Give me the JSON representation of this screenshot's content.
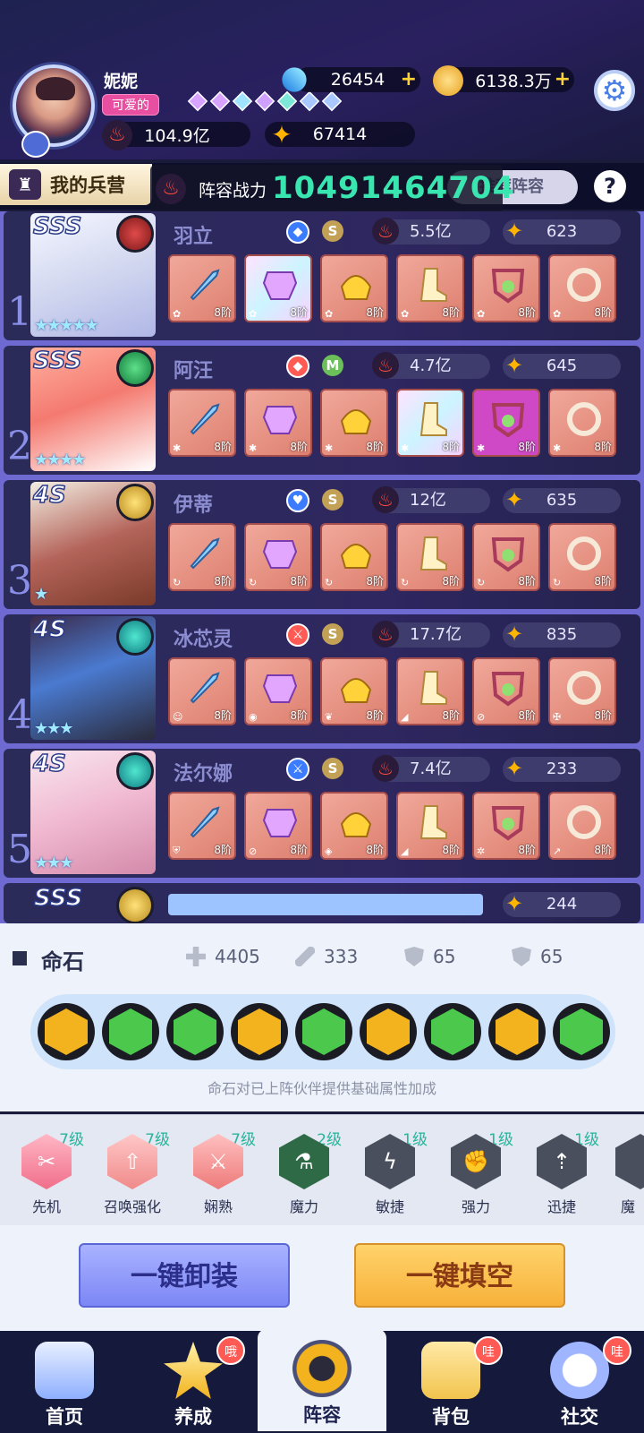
{
  "user": {
    "name": "妮妮",
    "tag": "可爱的",
    "diamonds": "26454",
    "gold": "6138.3万",
    "power": "104.9亿",
    "stars": "67414"
  },
  "tabs": {
    "my_camp": "我的兵营",
    "team_power_label": "阵容战力",
    "team_power": "10491464704",
    "recommend": "推荐阵容",
    "help": "?"
  },
  "heroes": [
    {
      "rank": "1",
      "tier": "SSS",
      "name": "羽立",
      "grade": "S",
      "power": "5.5亿",
      "level": "623",
      "stage": "8阶"
    },
    {
      "rank": "2",
      "tier": "SSS",
      "name": "阿汪",
      "grade": "M",
      "power": "4.7亿",
      "level": "645",
      "stage": "8阶"
    },
    {
      "rank": "3",
      "tier": "4S",
      "name": "伊蒂",
      "grade": "S",
      "power": "12亿",
      "level": "635",
      "stage": "8阶"
    },
    {
      "rank": "4",
      "tier": "4S",
      "name": "冰芯灵",
      "grade": "S",
      "power": "17.7亿",
      "level": "835",
      "stage": "8阶"
    },
    {
      "rank": "5",
      "tier": "4S",
      "name": "法尔娜",
      "grade": "S",
      "power": "7.4亿",
      "level": "233",
      "stage": "8阶"
    }
  ],
  "row6": {
    "tier": "SSS",
    "level": "244"
  },
  "stone_panel": {
    "title": "命石",
    "hp": "4405",
    "atk": "333",
    "def": "65",
    "mdef": "65",
    "note": "命石对已上阵伙伴提供基础属性加成"
  },
  "skills": [
    {
      "name": "先机",
      "level": "7级"
    },
    {
      "name": "召唤强化",
      "level": "7级"
    },
    {
      "name": "娴熟",
      "level": "7级"
    },
    {
      "name": "魔力",
      "level": "2级"
    },
    {
      "name": "敏捷",
      "level": "1级"
    },
    {
      "name": "强力",
      "level": "1级"
    },
    {
      "name": "迅捷",
      "level": "1级"
    },
    {
      "name": "魔",
      "level": ""
    }
  ],
  "actions": {
    "unequip": "一键卸装",
    "fill": "一键填空"
  },
  "nav": [
    {
      "label": "首页",
      "badge": ""
    },
    {
      "label": "养成",
      "badge": "哦"
    },
    {
      "label": "阵容",
      "badge": ""
    },
    {
      "label": "背包",
      "badge": "哇"
    },
    {
      "label": "社交",
      "badge": "哇"
    }
  ],
  "colors": {
    "accent": "#3ae6b0",
    "list_bg": "#6f6ad1",
    "unequip": "#8c95ff",
    "fill": "#f7b13a"
  }
}
